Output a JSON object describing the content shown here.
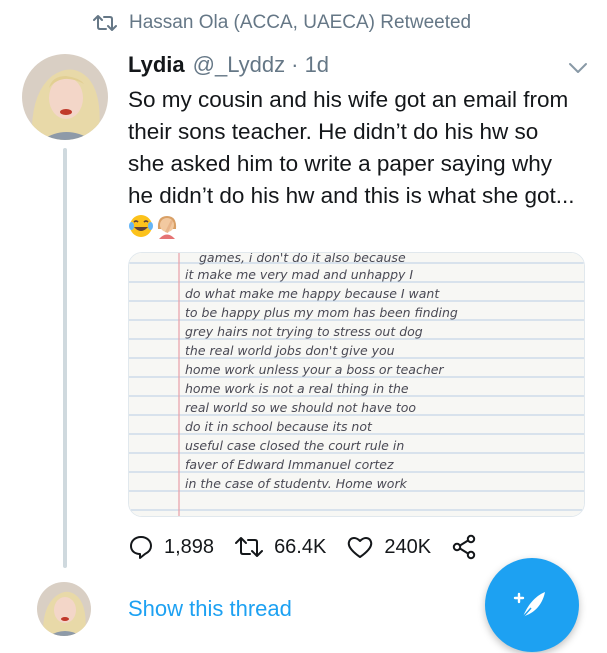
{
  "retweet": {
    "label": "Hassan Ola (ACCA, UAECA) Retweeted",
    "icon": "retweet-icon"
  },
  "tweet": {
    "author_name": "Lydia",
    "author_handle": "@_Lyddz",
    "time": "· 1d",
    "text": "So my cousin and his wife got an email from their sons teacher. He didn’t do his hw so she asked him to write a paper saying why he didn’t do his hw and this is what she got...",
    "emojis": [
      "face-with-tears-of-joy",
      "person-facepalming"
    ],
    "media": {
      "type": "handwritten-note-photo",
      "lines": [
        "games, i don't do it also because",
        "it make me very mad and unhappy I",
        "do what make me happy because I want",
        "to be happy plus my mom has been finding",
        "grey hairs not trying to stress out dog",
        "the real world jobs don't give you",
        "home work unless your a boss or teacher",
        "home work is not a real thing in the",
        "real world so we should not have too",
        "do it in school because its not",
        "useful case closed the court rule in",
        "faver of Edward Immanuel cortez",
        "in the case of studentv. Home work"
      ]
    }
  },
  "actions": {
    "replies": "1,898",
    "retweets": "66.4K",
    "likes": "240K"
  },
  "thread": {
    "show_label": "Show this thread"
  },
  "colors": {
    "accent": "#1da1f2",
    "secondary_text": "#657786",
    "primary_text": "#14171a"
  }
}
